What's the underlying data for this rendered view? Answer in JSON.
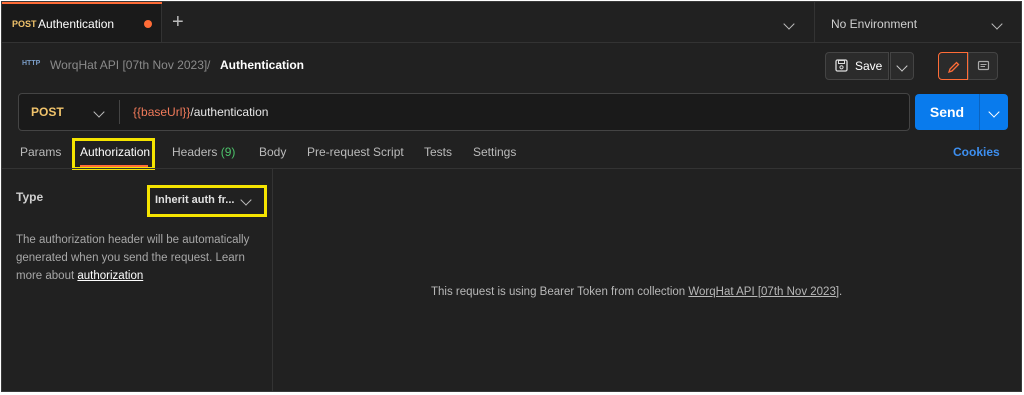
{
  "tab": {
    "method": "POST",
    "title": "Authentication"
  },
  "new_tab_icon": "+",
  "environment": {
    "label": "No Environment"
  },
  "breadcrumb": {
    "icon": "HTTP",
    "collection": "WorqHat API [07th Nov 2023]",
    "separator": "/",
    "current": "Authentication"
  },
  "toolbar": {
    "save_label": "Save"
  },
  "request": {
    "method": "POST",
    "url_variable": "{{baseUrl}}",
    "url_path": "/authentication",
    "send_label": "Send"
  },
  "request_tabs": {
    "params": "Params",
    "authorization": "Authorization",
    "headers": "Headers",
    "headers_count": "(9)",
    "body": "Body",
    "prerequest": "Pre-request Script",
    "tests": "Tests",
    "settings": "Settings",
    "cookies": "Cookies"
  },
  "auth": {
    "type_label": "Type",
    "type_value": "Inherit auth fr...",
    "description": "The authorization header will be automatically generated when you send the request. Learn more about",
    "learn_link": "authorization",
    "info_prefix": "This request is using Bearer Token from collection",
    "info_link": "WorqHat API [07th Nov 2023]",
    "info_suffix": "."
  },
  "colors": {
    "accent": "#ff6c37",
    "send": "#097bed",
    "highlight": "#f5e400",
    "method": "#f0c36b"
  }
}
